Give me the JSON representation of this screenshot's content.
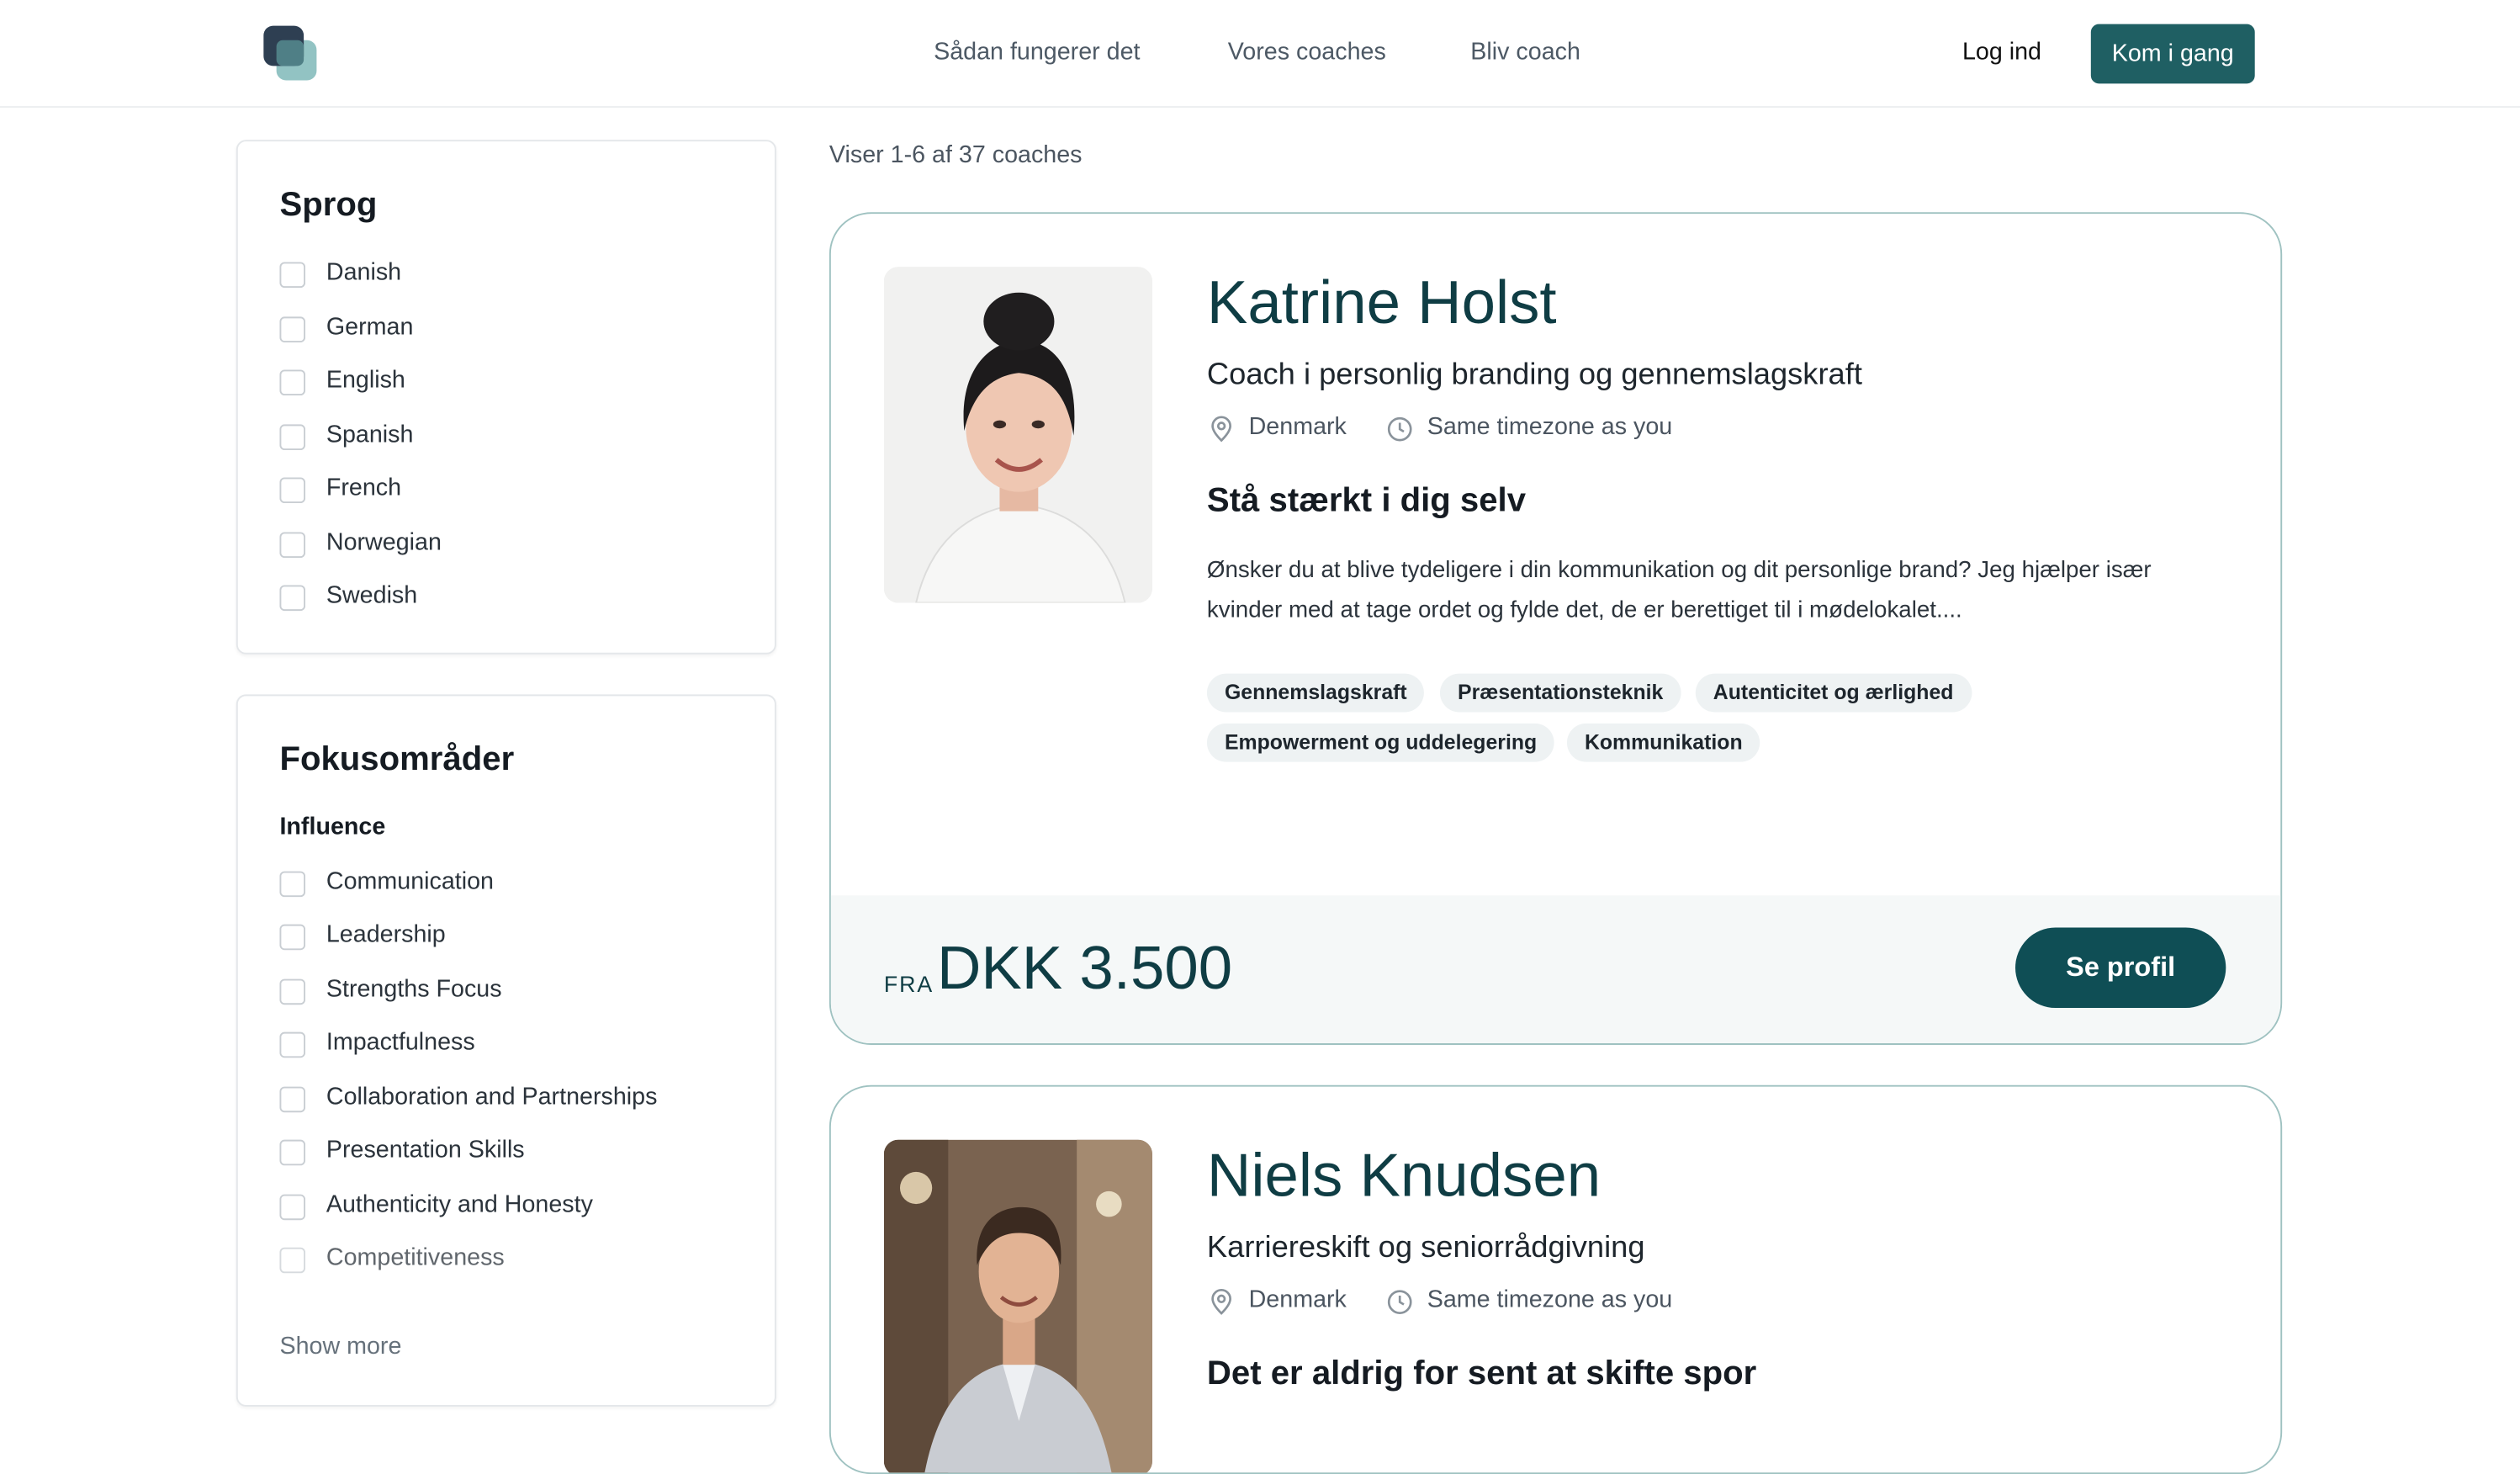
{
  "header": {
    "nav": [
      "Sådan fungerer det",
      "Vores coaches",
      "Bliv coach"
    ],
    "login": "Log ind",
    "cta": "Kom i gang"
  },
  "filters": {
    "language": {
      "title": "Sprog",
      "options": [
        "Danish",
        "German",
        "English",
        "Spanish",
        "French",
        "Norwegian",
        "Swedish"
      ]
    },
    "focus": {
      "title": "Fokusområder",
      "group": "Influence",
      "options": [
        "Communication",
        "Leadership",
        "Strengths Focus",
        "Impactfulness",
        "Collaboration and Partnerships",
        "Presentation Skills",
        "Authenticity and Honesty",
        "Competitiveness"
      ],
      "show_more": "Show more"
    }
  },
  "results": {
    "count_text": "Viser 1-6 af 37 coaches",
    "coaches": [
      {
        "name": "Katrine Holst",
        "role": "Coach i personlig branding og gennemslagskraft",
        "location": "Denmark",
        "timezone": "Same timezone as you",
        "headline": "Stå stærkt i dig selv",
        "description": "Ønsker du at blive tydeligere i din kommunikation og dit personlige brand? Jeg hjælper især kvinder med at tage ordet og fylde det, de er berettiget til i mødelokalet....",
        "tags": [
          "Gennemslagskraft",
          "Præsentationsteknik",
          "Autenticitet og ærlighed",
          "Empowerment og uddelegering",
          "Kommunikation"
        ],
        "price_prefix": "FRA",
        "price": "DKK 3.500",
        "button": "Se profil"
      },
      {
        "name": "Niels Knudsen",
        "role": "Karriereskift og seniorrådgivning",
        "location": "Denmark",
        "timezone": "Same timezone as you",
        "headline": "Det er aldrig for sent at skifte spor"
      }
    ]
  },
  "icons": {
    "location": "map-pin-icon",
    "timezone": "clock-icon"
  },
  "colors": {
    "brand": "#1f5f63",
    "accent_dark": "#0f4e55",
    "card_border": "#9fc2c1"
  }
}
